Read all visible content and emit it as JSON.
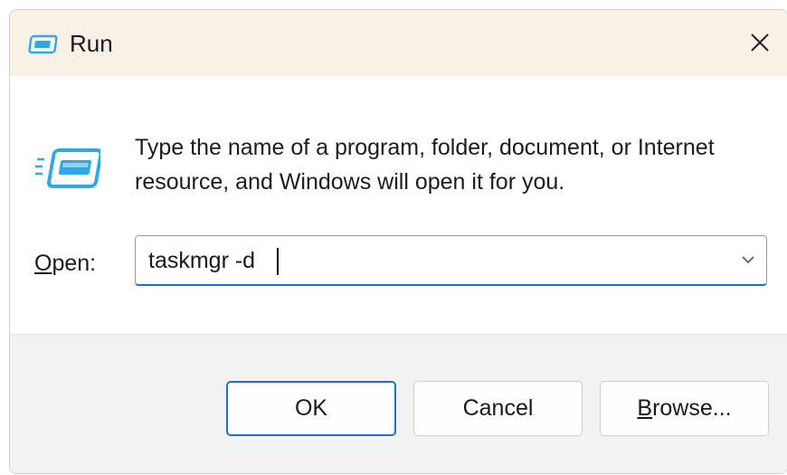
{
  "window": {
    "title": "Run",
    "close_glyph": "✕"
  },
  "dialog": {
    "description": "Type the name of a program, folder, document, or Internet resource, and Windows will open it for you.",
    "open_label_accel": "O",
    "open_label_rest": "pen:",
    "open_value": "taskmgr -d"
  },
  "buttons": {
    "ok": "OK",
    "cancel": "Cancel",
    "browse_accel": "B",
    "browse_rest": "rowse..."
  },
  "icons": {
    "title": "run-icon",
    "dialog": "run-icon",
    "dropdown": "chevron-down-icon",
    "close": "close-icon"
  },
  "colors": {
    "accent": "#1f6fd1",
    "titlebar": "#f7f1e6",
    "footer": "#f2f2f2",
    "icon_blue": "#2fa8e8"
  }
}
